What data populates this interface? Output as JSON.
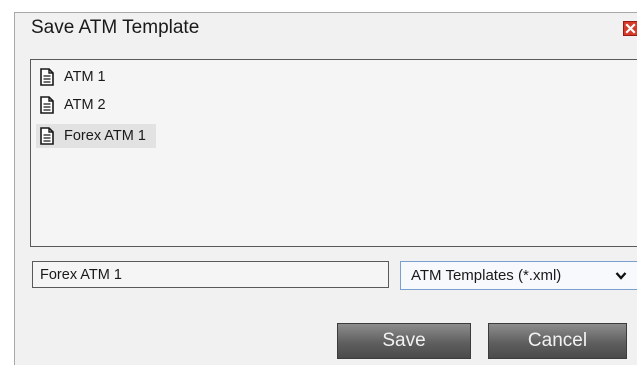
{
  "dialog": {
    "title": "Save ATM Template",
    "close_icon": "close-icon"
  },
  "file_list": {
    "items": [
      {
        "label": "ATM 1",
        "icon": "document-icon",
        "selected": false
      },
      {
        "label": "ATM 2",
        "icon": "document-icon",
        "selected": false
      },
      {
        "label": "Forex ATM 1",
        "icon": "document-icon",
        "selected": true
      }
    ]
  },
  "filename": {
    "value": "Forex ATM 1"
  },
  "filetype": {
    "selected": "ATM Templates (*.xml)",
    "icon": "chevron-down-icon"
  },
  "buttons": {
    "save_label": "Save",
    "cancel_label": "Cancel"
  },
  "colors": {
    "close_button": "#d83a2a",
    "button_dark": "#5f5f5f",
    "select_border": "#7aa0d0",
    "selected_row": "#e2e2e2"
  }
}
